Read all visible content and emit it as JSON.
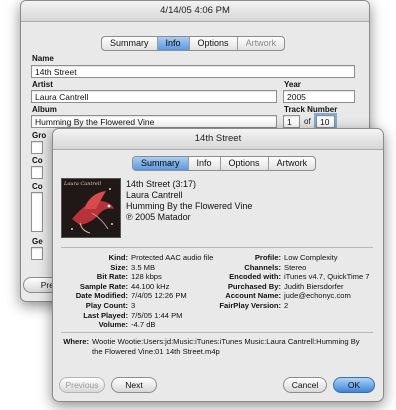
{
  "back_window": {
    "title": "4/14/05 4:06 PM",
    "tabs": [
      {
        "label": "Summary",
        "selected": false,
        "enabled": true
      },
      {
        "label": "Info",
        "selected": true,
        "enabled": true
      },
      {
        "label": "Options",
        "selected": false,
        "enabled": true
      },
      {
        "label": "Artwork",
        "selected": false,
        "enabled": false
      }
    ],
    "name_label": "Name",
    "name_value": "14th Street",
    "artist_label": "Artist",
    "artist_value": "Laura Cantrell",
    "year_label": "Year",
    "year_value": "2005",
    "album_label": "Album",
    "album_value": "Humming By the Flowered Vine",
    "track_label": "Track Number",
    "track_value": "1",
    "track_of": "of",
    "track_total": "10",
    "partial_labels": [
      "Gro",
      "Co",
      "Co",
      "Ge"
    ],
    "prev_button_partial": "Pre"
  },
  "front_window": {
    "title": "14th Street",
    "tabs": [
      {
        "label": "Summary",
        "selected": true
      },
      {
        "label": "Info",
        "selected": false
      },
      {
        "label": "Options",
        "selected": false
      },
      {
        "label": "Artwork",
        "selected": false
      }
    ],
    "header": {
      "title_time": "14th Street (3:17)",
      "artist": "Laura Cantrell",
      "album": "Humming By the Flowered Vine",
      "copyright": "℗ 2005 Matador"
    },
    "left_info": [
      {
        "key": "Kind:",
        "value": "Protected AAC audio file"
      },
      {
        "key": "Size:",
        "value": "3.5 MB"
      },
      {
        "key": "Bit Rate:",
        "value": "128 kbps"
      },
      {
        "key": "Sample Rate:",
        "value": "44.100 kHz"
      },
      {
        "key": "Date Modified:",
        "value": "7/4/05 12:26 PM"
      },
      {
        "key": "Play Count:",
        "value": "3"
      },
      {
        "key": "Last Played:",
        "value": "7/5/05 1:44 PM"
      },
      {
        "key": "Volume:",
        "value": "-4.7 dB"
      }
    ],
    "right_info": [
      {
        "key": "Profile:",
        "value": "Low Complexity"
      },
      {
        "key": "Channels:",
        "value": "Stereo"
      },
      {
        "key": "Encoded with:",
        "value": "iTunes v4.7, QuickTime 7"
      },
      {
        "key": "Purchased By:",
        "value": "Judith Biersdorfer"
      },
      {
        "key": "Account Name:",
        "value": "jude@echonyc.com"
      },
      {
        "key": "FairPlay Version:",
        "value": "2"
      }
    ],
    "where_label": "Where:",
    "where_value": "Wootie Wootie:Users:jd:Music:iTunes:iTunes Music:Laura Cantrell:Humming By the Flowered Vine:01 14th Street.m4p",
    "buttons": {
      "previous": "Previous",
      "next": "Next",
      "cancel": "Cancel",
      "ok": "OK"
    },
    "colors": {
      "selected_tab": "#5c98de",
      "ok_button": "#3f85d9",
      "window_bg": "#e9e9e9"
    }
  }
}
